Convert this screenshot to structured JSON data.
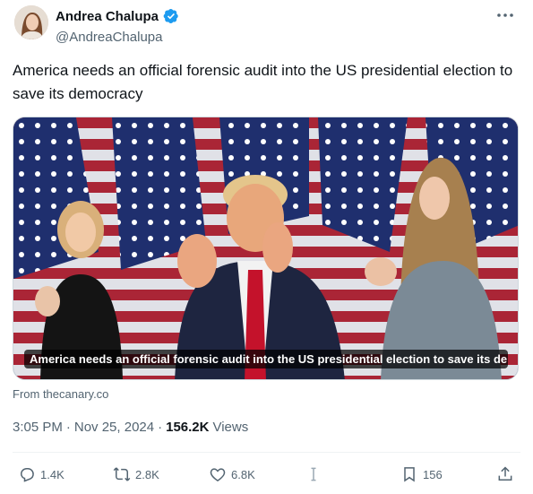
{
  "author": {
    "display_name": "Andrea Chalupa",
    "handle": "@AndreaChalupa",
    "verified": true,
    "verified_color": "#1d9bf0"
  },
  "tweet": {
    "text": "America needs an official forensic audit into the US presidential election to save its democracy"
  },
  "card": {
    "caption": "America needs an official forensic audit into the US presidential election to save its de...",
    "source": "From thecanary.co"
  },
  "meta": {
    "time": "3:05 PM",
    "separator1": "·",
    "date": "Nov 25, 2024",
    "separator2": "·",
    "views_count": "156.2K",
    "views_label": "Views"
  },
  "actions": {
    "replies": "1.4K",
    "reposts": "2.8K",
    "likes": "6.8K",
    "bookmarks": "156"
  },
  "icons": [
    "more-icon",
    "verified-icon",
    "reply-icon",
    "repost-icon",
    "like-icon",
    "analytics-icon",
    "bookmark-icon",
    "share-icon"
  ]
}
